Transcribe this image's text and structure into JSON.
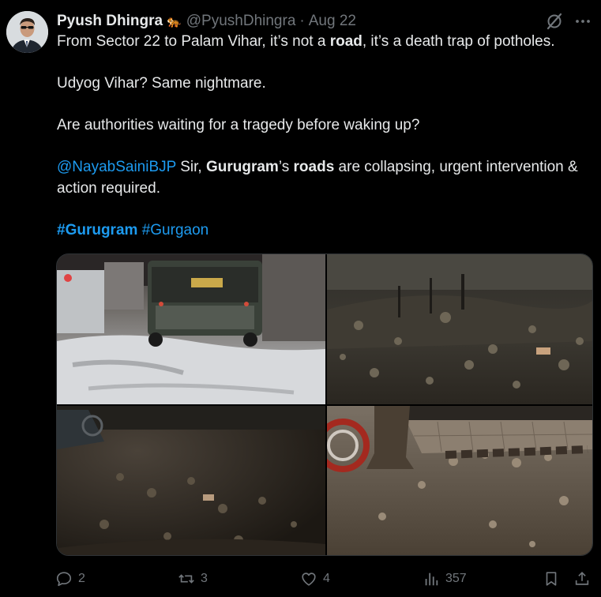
{
  "author": {
    "name": "Pyush Dhingra",
    "badge_emoji": "🐅",
    "handle": "@PyushDhingra",
    "separator": "·",
    "date": "Aug 22"
  },
  "tweet": {
    "line1_pre": "From Sector 22 to Palam Vihar, it’s not a ",
    "line1_bold": "road",
    "line1_post": ", it’s a death trap of potholes.",
    "line2": "Udyog Vihar? Same nightmare.",
    "line3": "Are authorities waiting for a tragedy before waking up?",
    "mention": "@NayabSainiBJP",
    "line4_a": " Sir, ",
    "line4_bold1": "Gurugram",
    "line4_b": "’s ",
    "line4_bold2": "roads",
    "line4_c": " are collapsing, urgent intervention & action required.",
    "hashtag1": "#Gurugram",
    "hashtag2": "#Gurgaon"
  },
  "stats": {
    "replies": "2",
    "reposts": "3",
    "likes": "4",
    "views": "357"
  },
  "colors": {
    "background": "#000000",
    "text": "#e7e9ea",
    "muted": "#71767b",
    "link": "#1d9bf0"
  },
  "icons": [
    "grok-icon",
    "more-icon",
    "reply-icon",
    "repost-icon",
    "like-icon",
    "views-icon",
    "bookmark-icon",
    "share-icon"
  ]
}
